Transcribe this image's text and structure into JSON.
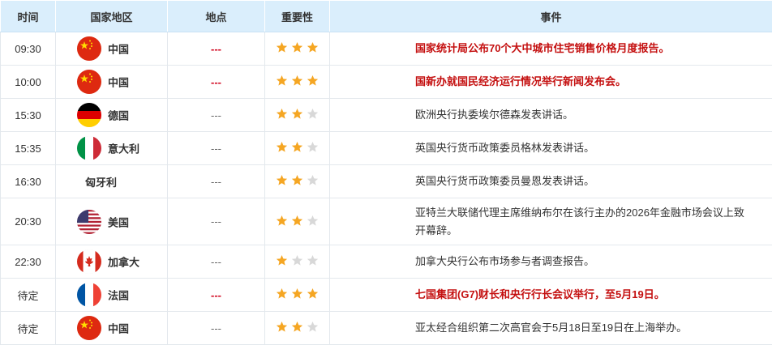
{
  "header": {
    "time": "时间",
    "region": "国家地区",
    "location": "地点",
    "importance": "重要性",
    "event": "事件"
  },
  "colors": {
    "header_bg": "#daeefc",
    "highlight_text": "#c40f0f",
    "star_on": "#f5a623",
    "star_off": "#d8d8d8"
  },
  "rows": [
    {
      "time": "09:30",
      "flag": "china-flag-icon",
      "country": "中国",
      "location": "---",
      "stars": 3,
      "event": "国家统计局公布70个大中城市住宅销售价格月度报告。",
      "highlight": true
    },
    {
      "time": "10:00",
      "flag": "china-flag-icon",
      "country": "中国",
      "location": "---",
      "stars": 3,
      "event": "国新办就国民经济运行情况举行新闻发布会。",
      "highlight": true
    },
    {
      "time": "15:30",
      "flag": "germany-flag-icon",
      "country": "德国",
      "location": "---",
      "stars": 2,
      "event": "欧洲央行执委埃尔德森发表讲话。",
      "highlight": false
    },
    {
      "time": "15:35",
      "flag": "italy-flag-icon",
      "country": "意大利",
      "location": "---",
      "stars": 2,
      "event": "英国央行货币政策委员格林发表讲话。",
      "highlight": false
    },
    {
      "time": "16:30",
      "flag": "",
      "country": "匈牙利",
      "location": "---",
      "stars": 2,
      "event": "英国央行货币政策委员曼恩发表讲话。",
      "highlight": false
    },
    {
      "time": "20:30",
      "flag": "usa-flag-icon",
      "country": "美国",
      "location": "---",
      "stars": 2,
      "event": "亚特兰大联储代理主席维纳布尔在该行主办的2026年金融市场会议上致开幕辞。",
      "highlight": false
    },
    {
      "time": "22:30",
      "flag": "canada-flag-icon",
      "country": "加拿大",
      "location": "---",
      "stars": 1,
      "event": "加拿大央行公布市场参与者调查报告。",
      "highlight": false
    },
    {
      "time": "待定",
      "flag": "france-flag-icon",
      "country": "法国",
      "location": "---",
      "stars": 3,
      "event": "七国集团(G7)财长和央行行长会议举行，至5月19日。",
      "highlight": true
    },
    {
      "time": "待定",
      "flag": "china-flag-icon",
      "country": "中国",
      "location": "---",
      "stars": 2,
      "event": "亚太经合组织第二次高官会于5月18日至19日在上海举办。",
      "highlight": false
    }
  ]
}
